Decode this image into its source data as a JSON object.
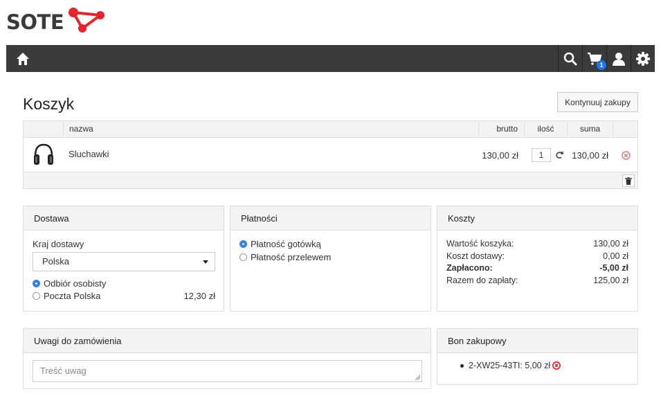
{
  "logo": {
    "text": "SOTE",
    "accent_color": "#e8232a"
  },
  "navbar": {
    "home_icon": "home-icon",
    "icons": [
      "search-icon",
      "cart-icon",
      "user-icon",
      "gear-icon"
    ],
    "cart_count": "1"
  },
  "page": {
    "title": "Koszyk",
    "continue_label": "Kontynuuj zakupy"
  },
  "cart": {
    "headers": {
      "name": "nazwa",
      "gross": "brutto",
      "qty": "ilość",
      "sum": "suma"
    },
    "items": [
      {
        "icon": "headphones-icon",
        "name": "Sluchawki",
        "gross": "130,00 zł",
        "qty": "1",
        "sum": "130,00 zł"
      }
    ]
  },
  "delivery": {
    "title": "Dostawa",
    "country_label": "Kraj dostawy",
    "country_value": "Polska",
    "options": [
      {
        "label": "Odbiór osobisty",
        "price": "",
        "selected": true
      },
      {
        "label": "Poczta Polska",
        "price": "12,30 zł",
        "selected": false
      }
    ]
  },
  "payment": {
    "title": "Płatności",
    "options": [
      {
        "label": "Płatność gotówką",
        "selected": true
      },
      {
        "label": "Płatność przelewem",
        "selected": false
      }
    ]
  },
  "costs": {
    "title": "Koszty",
    "rows": [
      {
        "label": "Wartość koszyka:",
        "value": "130,00 zł"
      },
      {
        "label": "Koszt dostawy:",
        "value": "0,00 zł"
      },
      {
        "label": "Zapłacono:",
        "value": "-5,00 zł"
      },
      {
        "label": "Razem do zapłaty:",
        "value": "125,00 zł"
      }
    ]
  },
  "notes": {
    "title": "Uwagi do zamówienia",
    "placeholder": "Treść uwag"
  },
  "voucher": {
    "title": "Bon zakupowy",
    "item": "2-XW25-43TI: 5,00 zł",
    "remove_color": "#e8232a"
  }
}
